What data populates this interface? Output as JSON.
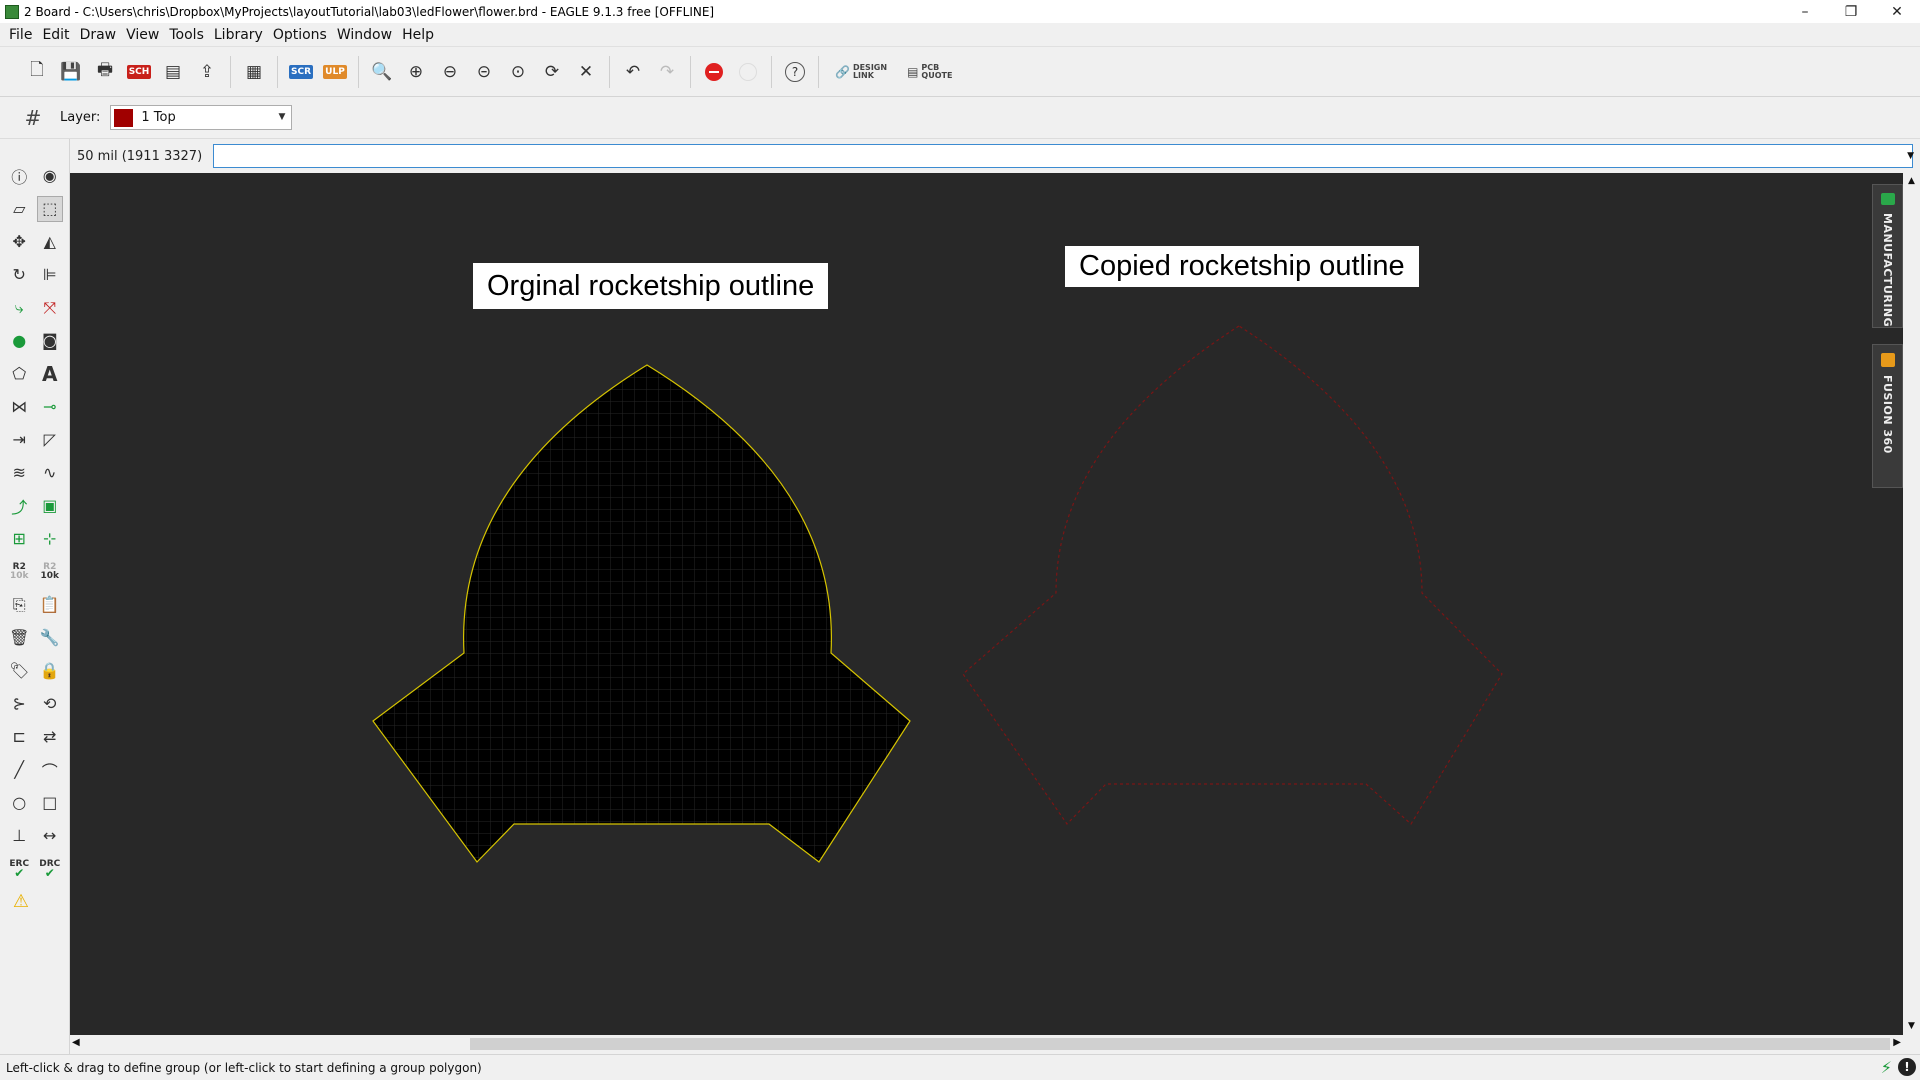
{
  "window": {
    "title": "2 Board - C:\\Users\\chris\\Dropbox\\MyProjects\\layoutTutorial\\lab03\\ledFlower\\flower.brd - EAGLE 9.1.3 free [OFFLINE]",
    "minimize": "–",
    "restore": "❐",
    "close": "✕"
  },
  "menu": [
    "File",
    "Edit",
    "Draw",
    "View",
    "Tools",
    "Library",
    "Options",
    "Window",
    "Help"
  ],
  "toolbar": {
    "sch_label": "SCH",
    "scr_label": "SCR",
    "ulp_label": "ULP",
    "design_link_line1": "DESIGN",
    "design_link_line2": "LINK",
    "pcb_quote_line1": "PCB",
    "pcb_quote_line2": "QUOTE",
    "help": "?"
  },
  "layer": {
    "label": "Layer:",
    "selected": "1 Top",
    "color": "#a00000"
  },
  "command": {
    "coordinates": "50 mil (1911 3327)",
    "value": ""
  },
  "sidebar": {
    "r2_label": "R2",
    "r2_sub": "10k",
    "erc_label": "ERC",
    "drc_label": "DRC"
  },
  "canvas": {
    "background": "#282828",
    "label_original": "Orginal rocketship outline",
    "label_copied": "Copied rocketship outline",
    "original_outline_color": "#d6c400",
    "copy_outline_color": "#7a1515"
  },
  "side_tabs": {
    "manufacturing": "MANUFACTURING",
    "fusion": "FUSION 360"
  },
  "status": {
    "message": "Left-click & drag to define group (or left-click to start defining a group polygon)"
  }
}
